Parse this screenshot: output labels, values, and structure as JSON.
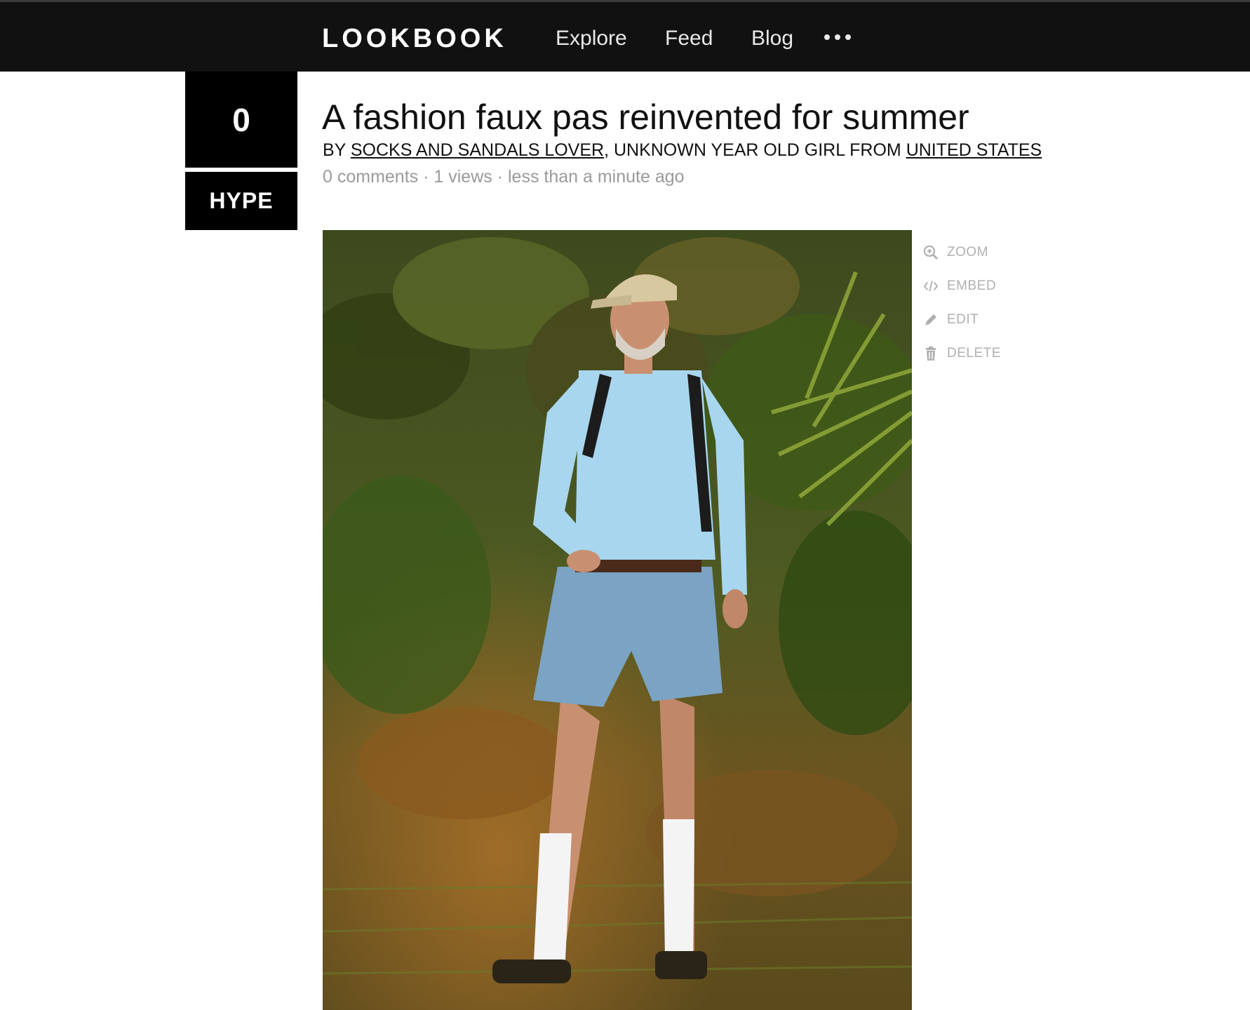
{
  "nav": {
    "logo": "LOOKBOOK",
    "links": [
      "Explore",
      "Feed",
      "Blog"
    ],
    "more_icon": "ellipsis-icon"
  },
  "hype": {
    "count": "0",
    "button_label": "HYPE"
  },
  "post": {
    "title": "A fashion faux pas reinvented for summer",
    "by_prefix": "BY ",
    "author": "SOCKS AND SANDALS LOVER",
    "author_suffix": ", UNKNOWN YEAR OLD GIRL FROM ",
    "location": "UNITED STATES",
    "comments": "0 comments",
    "views": "1 views",
    "time": "less than a minute ago",
    "separator": " · "
  },
  "actions": [
    {
      "label": "ZOOM",
      "icon": "zoom-icon"
    },
    {
      "label": "EMBED",
      "icon": "embed-icon"
    },
    {
      "label": "EDIT",
      "icon": "pencil-icon"
    },
    {
      "label": "DELETE",
      "icon": "trash-icon"
    }
  ],
  "colors": {
    "nav_bg": "#111111",
    "hype_bg": "#000000",
    "meta_text": "#9a9a9a",
    "action_text": "#b0b0b0"
  }
}
